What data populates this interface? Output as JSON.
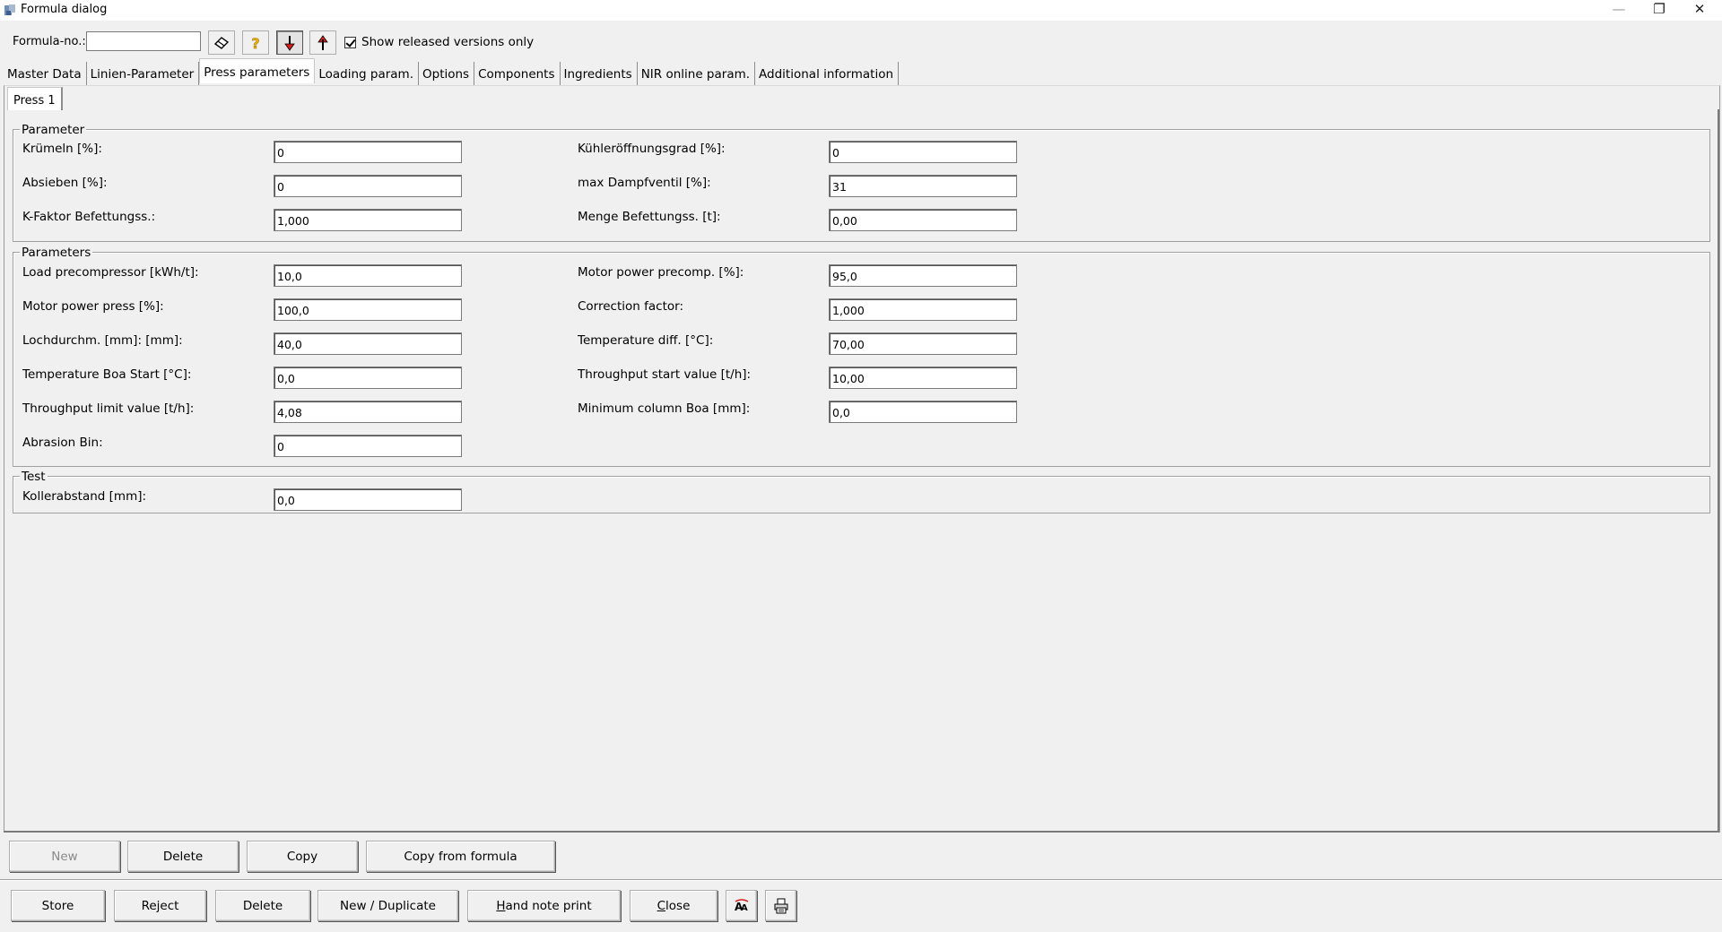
{
  "window": {
    "title": "Formula dialog",
    "minimize_glyph": "—",
    "restore_glyph": "❐",
    "close_glyph": "✕"
  },
  "toolbar": {
    "formula_label": "Formula-no.:",
    "formula_value": "",
    "icons": [
      "eraser-icon",
      "help-icon",
      "arrow-down-icon",
      "arrow-up-icon"
    ],
    "show_released_label": "Show released versions only",
    "show_released_checked": true
  },
  "tabs": [
    {
      "label": "Master Data",
      "active": false
    },
    {
      "label": "Linien-Parameter",
      "active": false
    },
    {
      "label": "Press parameters",
      "active": true
    },
    {
      "label": "Loading param.",
      "active": false
    },
    {
      "label": "Options",
      "active": false
    },
    {
      "label": "Components",
      "active": false
    },
    {
      "label": "Ingredients",
      "active": false
    },
    {
      "label": "NIR online param.",
      "active": false
    },
    {
      "label": "Additional information",
      "active": false
    }
  ],
  "subtab": {
    "label": "Press 1"
  },
  "groups": {
    "parameter": {
      "title": "Parameter",
      "fields": [
        {
          "label": "Krümeln [%]:",
          "value": "0"
        },
        {
          "label": "Kühleröffnungsgrad [%]:",
          "value": "0"
        },
        {
          "label": "Absieben [%]:",
          "value": "0"
        },
        {
          "label": "max Dampfventil [%]:",
          "value": "31"
        },
        {
          "label": "K-Faktor Befettungss.:",
          "value": "1,000"
        },
        {
          "label": "Menge Befettungss. [t]:",
          "value": "0,00"
        }
      ]
    },
    "parameters": {
      "title": "Parameters",
      "fields": [
        {
          "label": "Load precompressor [kWh/t]:",
          "value": "10,0"
        },
        {
          "label": "Motor power precomp. [%]:",
          "value": "95,0"
        },
        {
          "label": "Motor power press [%]:",
          "value": "100,0"
        },
        {
          "label": "Correction factor:",
          "value": "1,000"
        },
        {
          "label": "Lochdurchm. [mm]: [mm]:",
          "value": "40,0"
        },
        {
          "label": "Temperature diff. [°C]:",
          "value": "70,00"
        },
        {
          "label": "Temperature Boa Start [°C]:",
          "value": "0,0"
        },
        {
          "label": "Throughput start value [t/h]:",
          "value": "10,00"
        },
        {
          "label": "Throughput limit value [t/h]:",
          "value": "4,08"
        },
        {
          "label": "Minimum column Boa [mm]:",
          "value": "0,0"
        },
        {
          "label": "Abrasion Bin:",
          "value": "0"
        }
      ]
    },
    "test": {
      "title": "Test",
      "fields": [
        {
          "label": "Kollerabstand [mm]:",
          "value": "0,0"
        }
      ]
    }
  },
  "inner_buttons": {
    "new": "New",
    "delete": "Delete",
    "copy": "Copy",
    "copy_from_formula": "Copy from formula"
  },
  "bottom_buttons": {
    "store": "Store",
    "reject": "Reject",
    "delete": "Delete",
    "new_duplicate": "New / Duplicate",
    "hand_note_print_first": "H",
    "hand_note_print_rest": "and note print",
    "close_first": "C",
    "close_rest": "lose",
    "icons": [
      "font-size-icon",
      "printer-icon"
    ]
  }
}
